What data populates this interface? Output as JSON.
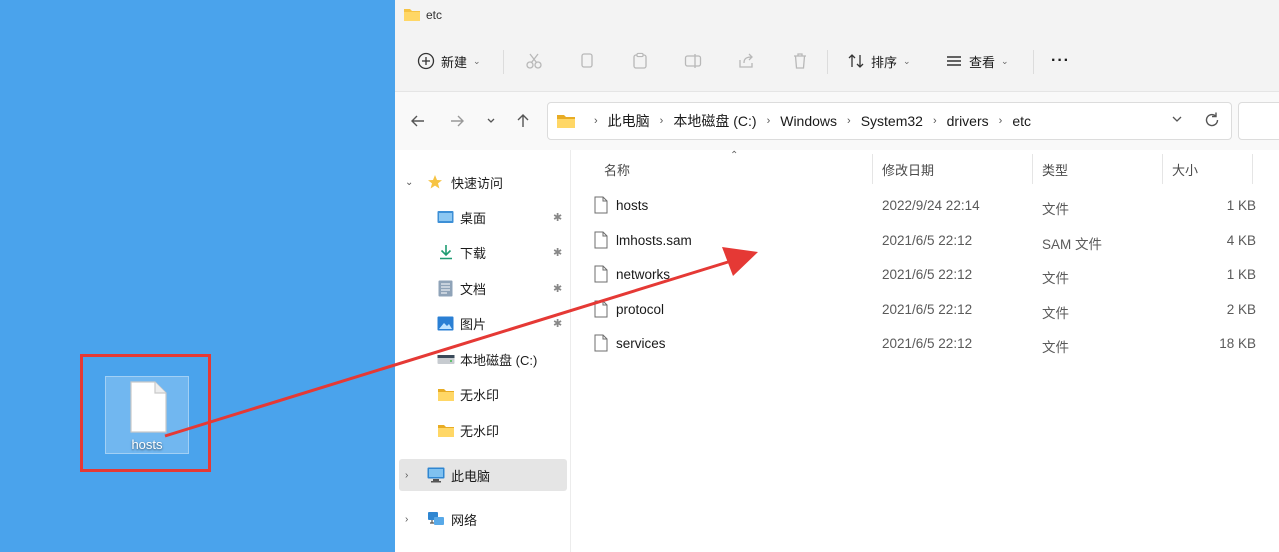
{
  "desktop": {
    "file_label": "hosts"
  },
  "window": {
    "title": "etc"
  },
  "toolbar": {
    "new_label": "新建",
    "sort_label": "排序",
    "view_label": "查看",
    "more_label": "···"
  },
  "address": {
    "crumbs": [
      "此电脑",
      "本地磁盘 (C:)",
      "Windows",
      "System32",
      "drivers",
      "etc"
    ]
  },
  "sidebar": {
    "quick_access": "快速访问",
    "items": [
      {
        "label": "桌面",
        "icon": "desktop-icon"
      },
      {
        "label": "下载",
        "icon": "download-icon"
      },
      {
        "label": "文档",
        "icon": "document-icon"
      },
      {
        "label": "图片",
        "icon": "pictures-icon"
      },
      {
        "label": "本地磁盘 (C:)",
        "icon": "drive-icon"
      },
      {
        "label": "无水印",
        "icon": "folder-icon"
      },
      {
        "label": "无水印",
        "icon": "folder-icon"
      }
    ],
    "this_pc": "此电脑",
    "network": "网络"
  },
  "columns": {
    "name": "名称",
    "date": "修改日期",
    "type": "类型",
    "size": "大小"
  },
  "files": [
    {
      "name": "hosts",
      "date": "2022/9/24 22:14",
      "type": "文件",
      "size": "1 KB"
    },
    {
      "name": "lmhosts.sam",
      "date": "2021/6/5 22:12",
      "type": "SAM 文件",
      "size": "4 KB"
    },
    {
      "name": "networks",
      "date": "2021/6/5 22:12",
      "type": "文件",
      "size": "1 KB"
    },
    {
      "name": "protocol",
      "date": "2021/6/5 22:12",
      "type": "文件",
      "size": "2 KB"
    },
    {
      "name": "services",
      "date": "2021/6/5 22:12",
      "type": "文件",
      "size": "18 KB"
    }
  ],
  "colors": {
    "desktop_bg": "#4aa3ec",
    "highlight_red": "#e53935",
    "folder_yellow": "#f6c343"
  }
}
